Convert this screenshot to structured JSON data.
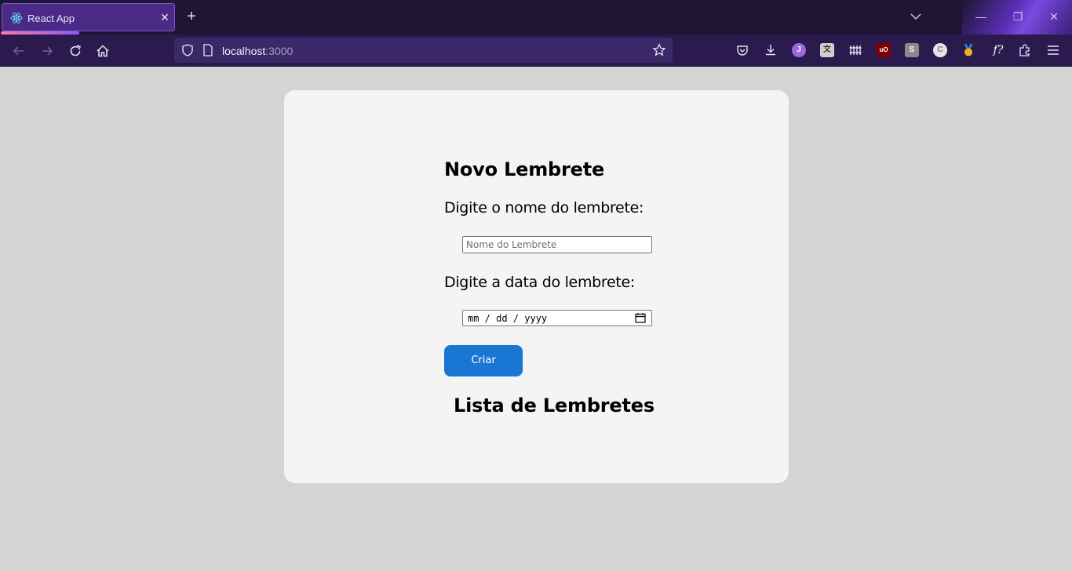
{
  "browser": {
    "tab_title": "React App",
    "url_host": "localhost",
    "url_port": ":3000",
    "extensions": [
      "pocket-icon",
      "download-icon",
      "j-extension-icon",
      "translate-extension-icon",
      "library-extension-icon",
      "ublock-icon",
      "s-extension-icon",
      "c-extension-icon",
      "medal-extension-icon",
      "fx-extension-icon",
      "puzzle-icon",
      "menu-icon"
    ],
    "ext_letters": {
      "j": "J",
      "ublock": "uO",
      "s": "S",
      "c": "C",
      "fx": "f?"
    }
  },
  "form": {
    "title": "Novo Lembrete",
    "name_label": "Digite o nome do lembrete:",
    "name_placeholder": "Nome do Lembrete",
    "date_label": "Digite a data do lembrete:",
    "date_placeholder": "mm / dd / yyyy",
    "submit_label": "Criar"
  },
  "list": {
    "title": "Lista de Lembretes"
  },
  "colors": {
    "button": "#1976d2",
    "card": "#f4f4f4",
    "page_bg": "#d4d4d4",
    "chrome": "#2b1a4d"
  }
}
